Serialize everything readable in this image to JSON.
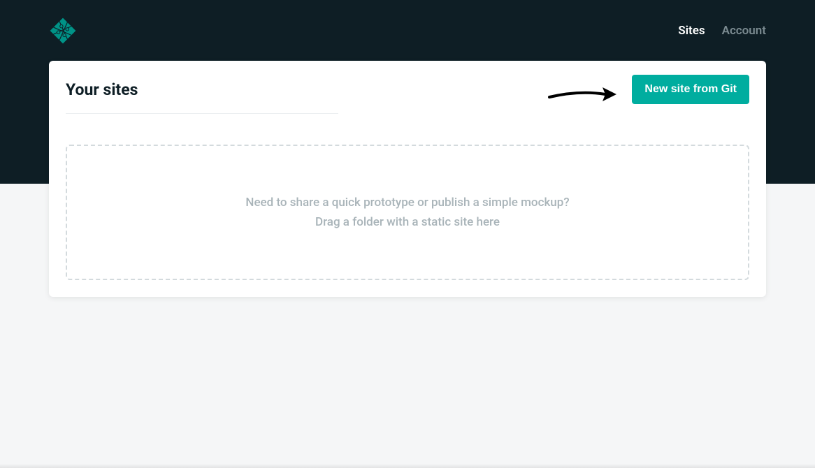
{
  "nav": {
    "sites": "Sites",
    "account": "Account"
  },
  "page": {
    "title": "Your sites",
    "new_site_button": "New site from Git"
  },
  "dropzone": {
    "line1": "Need to share a quick prototype or publish a simple mockup?",
    "line2": "Drag a folder with a static site here"
  }
}
